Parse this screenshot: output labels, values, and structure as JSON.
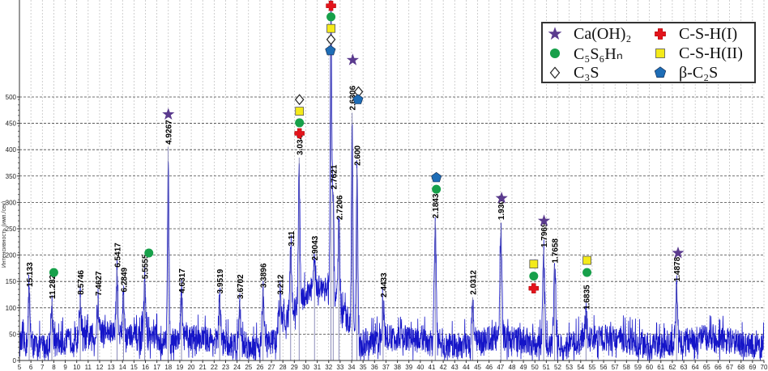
{
  "chart_data": {
    "type": "line",
    "title": "",
    "xlabel": "",
    "ylabel": "Интенсивность (имп./сек)",
    "xlim": [
      5,
      70
    ],
    "ylim": [
      0,
      684
    ],
    "x_ticks": [
      5,
      6,
      7,
      8,
      9,
      10,
      11,
      12,
      13,
      14,
      15,
      16,
      17,
      18,
      19,
      20,
      21,
      22,
      23,
      24,
      25,
      26,
      27,
      28,
      29,
      30,
      31,
      32,
      33,
      34,
      35,
      36,
      37,
      38,
      39,
      40,
      41,
      42,
      43,
      44,
      45,
      46,
      47,
      48,
      49,
      50,
      51,
      52,
      53,
      54,
      55,
      56,
      57,
      58,
      59,
      60,
      61,
      62,
      63,
      64,
      65,
      66,
      67,
      68,
      69,
      70
    ],
    "y_ticks": [
      0,
      50,
      100,
      150,
      200,
      250,
      300,
      350,
      400,
      450,
      500
    ],
    "grid": true,
    "series_color": "#1515c8",
    "peaks": [
      {
        "two_theta": 5.85,
        "intensity": 135,
        "label": "15.133"
      },
      {
        "two_theta": 7.83,
        "intensity": 112,
        "label": "11.282"
      },
      {
        "two_theta": 10.31,
        "intensity": 120,
        "label": "8.5746"
      },
      {
        "two_theta": 11.85,
        "intensity": 118,
        "label": "7.4627"
      },
      {
        "two_theta": 13.52,
        "intensity": 172,
        "label": "6.5417"
      },
      {
        "two_theta": 14.08,
        "intensity": 125,
        "label": "6.2849"
      },
      {
        "two_theta": 15.94,
        "intensity": 150,
        "label": "5.5555"
      },
      {
        "two_theta": 17.99,
        "intensity": 405,
        "label": "4.9267"
      },
      {
        "two_theta": 19.15,
        "intensity": 123,
        "label": "4.6317"
      },
      {
        "two_theta": 22.48,
        "intensity": 122,
        "label": "3.9519"
      },
      {
        "two_theta": 24.23,
        "intensity": 112,
        "label": "3.6702"
      },
      {
        "two_theta": 26.27,
        "intensity": 133,
        "label": "3.3896"
      },
      {
        "two_theta": 27.75,
        "intensity": 120,
        "label": "3.212"
      },
      {
        "two_theta": 28.68,
        "intensity": 212,
        "label": "3.11"
      },
      {
        "two_theta": 29.42,
        "intensity": 385,
        "label": "3.034"
      },
      {
        "two_theta": 30.76,
        "intensity": 185,
        "label": "2.9043"
      },
      {
        "two_theta": 32.2,
        "intensity": 700,
        "label": ""
      },
      {
        "two_theta": 32.39,
        "intensity": 320,
        "label": "2.7621"
      },
      {
        "two_theta": 32.89,
        "intensity": 262,
        "label": "2.7206"
      },
      {
        "two_theta": 34.05,
        "intensity": 470,
        "label": "2.6306"
      },
      {
        "two_theta": 34.47,
        "intensity": 365,
        "label": "2.600"
      },
      {
        "two_theta": 36.75,
        "intensity": 115,
        "label": "2.4433"
      },
      {
        "two_theta": 41.3,
        "intensity": 265,
        "label": "2.1843"
      },
      {
        "two_theta": 44.57,
        "intensity": 120,
        "label": "2.0312"
      },
      {
        "two_theta": 47.03,
        "intensity": 262,
        "label": "1.9309"
      },
      {
        "two_theta": 50.77,
        "intensity": 210,
        "label": "1.7969"
      },
      {
        "two_theta": 51.73,
        "intensity": 180,
        "label": "1.7658"
      },
      {
        "two_theta": 54.46,
        "intensity": 92,
        "label": "1.6835"
      },
      {
        "two_theta": 62.37,
        "intensity": 145,
        "label": "1.4878"
      }
    ],
    "phase_markers": [
      {
        "phase": "C5S6Hn",
        "two_theta": 8.0,
        "intensity": 167
      },
      {
        "phase": "C5S6Hn",
        "two_theta": 16.3,
        "intensity": 204
      },
      {
        "phase": "CaOH2",
        "two_theta": 18.0,
        "intensity": 467
      },
      {
        "phase": "C3S",
        "two_theta": 29.45,
        "intensity": 495
      },
      {
        "phase": "CSH2",
        "two_theta": 29.45,
        "intensity": 473
      },
      {
        "phase": "C5S6Hn",
        "two_theta": 29.45,
        "intensity": 451
      },
      {
        "phase": "CSH1",
        "two_theta": 29.45,
        "intensity": 431
      },
      {
        "phase": "CSH1",
        "two_theta": 32.2,
        "intensity": 673
      },
      {
        "phase": "C5S6Hn",
        "two_theta": 32.2,
        "intensity": 652
      },
      {
        "phase": "CSH2",
        "two_theta": 32.2,
        "intensity": 630
      },
      {
        "phase": "C3S",
        "two_theta": 32.2,
        "intensity": 609
      },
      {
        "phase": "bC2S",
        "two_theta": 32.15,
        "intensity": 588
      },
      {
        "phase": "CaOH2",
        "two_theta": 34.1,
        "intensity": 570
      },
      {
        "phase": "C3S",
        "two_theta": 34.6,
        "intensity": 510
      },
      {
        "phase": "bC2S",
        "two_theta": 34.55,
        "intensity": 495
      },
      {
        "phase": "bC2S",
        "two_theta": 41.4,
        "intensity": 347
      },
      {
        "phase": "C5S6Hn",
        "two_theta": 41.4,
        "intensity": 325
      },
      {
        "phase": "CaOH2",
        "two_theta": 47.1,
        "intensity": 308
      },
      {
        "phase": "CaOH2",
        "two_theta": 50.8,
        "intensity": 265
      },
      {
        "phase": "CSH2",
        "two_theta": 49.9,
        "intensity": 183
      },
      {
        "phase": "C5S6Hn",
        "two_theta": 49.9,
        "intensity": 160
      },
      {
        "phase": "CSH1",
        "two_theta": 49.9,
        "intensity": 137
      },
      {
        "phase": "CSH2",
        "two_theta": 54.55,
        "intensity": 190
      },
      {
        "phase": "C5S6Hn",
        "two_theta": 54.55,
        "intensity": 167
      },
      {
        "phase": "CaOH2",
        "two_theta": 62.5,
        "intensity": 204
      }
    ],
    "legend_position": "top-right",
    "legend": [
      {
        "key": "CaOH2",
        "label": "Ca(OH)₂",
        "shape": "star",
        "color": "#5a3a8e"
      },
      {
        "key": "CSH1",
        "label": "C-S-H(I)",
        "shape": "cross",
        "color": "#e3141c"
      },
      {
        "key": "C5S6Hn",
        "label": "C₅S₆Hₙ",
        "shape": "circle",
        "color": "#17a04a"
      },
      {
        "key": "CSH2",
        "label": "C-S-H(II)",
        "shape": "square",
        "color": "#f4ea1a"
      },
      {
        "key": "C3S",
        "label": "C₃S",
        "shape": "diamond",
        "color": "#ffffff"
      },
      {
        "key": "bC2S",
        "label": "β-C₂S",
        "shape": "pentagon",
        "color": "#1e6db6"
      }
    ]
  }
}
